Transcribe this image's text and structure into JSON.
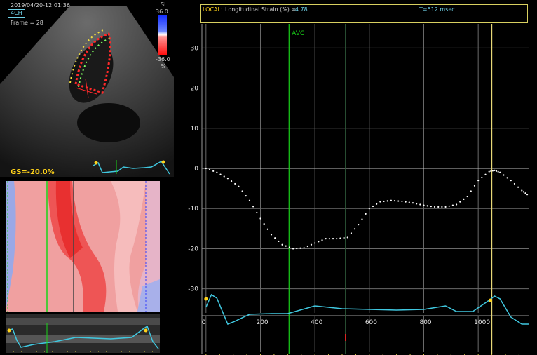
{
  "echo": {
    "timestamp": "2019/04/20-12:01:36",
    "view": "4CH",
    "frame": "Frame = 28",
    "global_strain": "GS=-20.0%",
    "colorbar": {
      "label": "SL",
      "max": "36.0",
      "min": "-36.0",
      "unit": "%"
    }
  },
  "header": {
    "local_label": "LOCAL:",
    "title": "Longitudinal Strain (%) =",
    "value": "-4.78",
    "time": "T=512 msec"
  },
  "colors": {
    "avc": "#19d419",
    "marker": "#e8d878",
    "trace": "#40c8e0",
    "accent": "#ffd21a"
  },
  "chart_data": {
    "type": "scatter",
    "title": "",
    "xlabel": "",
    "ylabel": "Longitudinal Strain (%)",
    "x_ticks": [
      "0",
      "200",
      "400",
      "600",
      "800",
      "1000"
    ],
    "y_ticks": [
      "30",
      "20",
      "10",
      "0",
      "-10",
      "-20",
      "-30"
    ],
    "xlim": [
      -15,
      1185
    ],
    "ylim": [
      -36,
      36
    ],
    "grid": true,
    "annotations": [
      {
        "label": "AVC",
        "x": 305
      }
    ],
    "cursor_x": 512,
    "marker_x": 1050,
    "points": [
      [
        0,
        0
      ],
      [
        40,
        -1
      ],
      [
        80,
        -2.5
      ],
      [
        120,
        -4.5
      ],
      [
        160,
        -8
      ],
      [
        200,
        -12.5
      ],
      [
        240,
        -16.5
      ],
      [
        280,
        -19
      ],
      [
        320,
        -20
      ],
      [
        360,
        -19.8
      ],
      [
        400,
        -18.6
      ],
      [
        440,
        -17.5
      ],
      [
        480,
        -17.5
      ],
      [
        520,
        -17.2
      ],
      [
        560,
        -14
      ],
      [
        600,
        -10
      ],
      [
        640,
        -8.3
      ],
      [
        680,
        -8
      ],
      [
        720,
        -8.2
      ],
      [
        760,
        -8.6
      ],
      [
        800,
        -9.2
      ],
      [
        840,
        -9.6
      ],
      [
        880,
        -9.6
      ],
      [
        920,
        -9
      ],
      [
        960,
        -7
      ],
      [
        1000,
        -3
      ],
      [
        1040,
        -0.8
      ],
      [
        1060,
        -0.5
      ],
      [
        1080,
        -1
      ],
      [
        1120,
        -3
      ],
      [
        1160,
        -5.5
      ],
      [
        1180,
        -6.5
      ]
    ]
  }
}
